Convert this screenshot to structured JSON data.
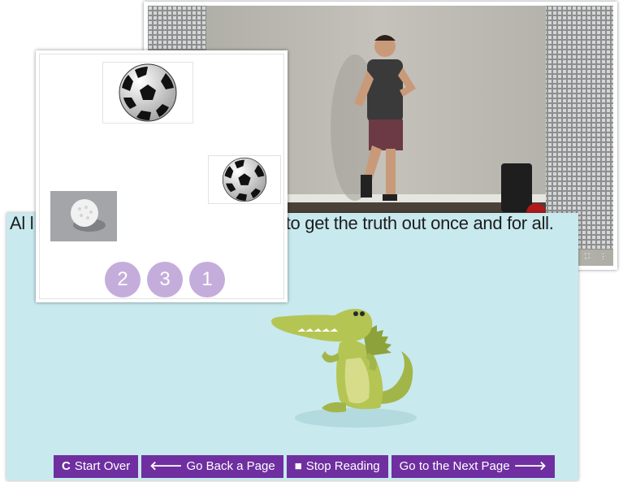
{
  "video": {
    "controls": [
      "⛶",
      "⋮"
    ]
  },
  "story": {
    "text_left": "Al l",
    "text_right": "e to get the truth out once and for all."
  },
  "nav_buttons": [
    {
      "icon": "C",
      "label": "Start Over"
    },
    {
      "icon": "🡐",
      "label": "Go Back a Page"
    },
    {
      "icon": "■",
      "label": "Stop Reading"
    },
    {
      "icon": "🡒",
      "label": "Go to the Next Page"
    }
  ],
  "ordering": {
    "numbers": [
      "2",
      "3",
      "1"
    ]
  },
  "colors": {
    "story_bg": "#c8e9ee",
    "button_purple": "#6f2fa0",
    "order_circle": "#c4addb"
  }
}
